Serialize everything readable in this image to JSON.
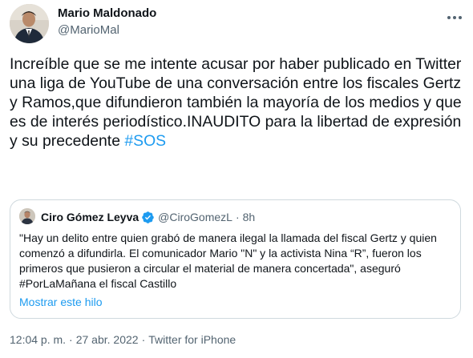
{
  "author": {
    "name": "Mario Maldonado",
    "handle": "@MarioMal"
  },
  "tweet": {
    "text": "Increíble que se me intente acusar por haber publicado en Twitter una liga de YouTube de una conversación entre los fiscales Gertz y Ramos,que difundieron también la mayoría de los medios y que es de interés periodístico.INAUDITO para la libertad de expresión y su precedente ",
    "hashtag": "#SOS"
  },
  "quote": {
    "name": "Ciro Gómez Leyva",
    "handle": "@CiroGomezL",
    "separator": "·",
    "time": "8h",
    "text": "\"Hay un delito entre quien grabó de manera ilegal la llamada del fiscal Gertz y quien comenzó a difundirla. El comunicador Mario \"N\" y la activista Nina “R”, fueron los primeros que pusieron a circular el material de manera concertada\", aseguró #PorLaMañana el fiscal Castillo",
    "show_thread": "Mostrar este hilo",
    "verified": true
  },
  "meta": {
    "time": "12:04 p. m.",
    "date": "27 abr. 2022",
    "source": "Twitter for iPhone",
    "separator": "·"
  },
  "colors": {
    "text": "#0f1419",
    "secondary": "#536471",
    "accent": "#1d9bf0",
    "border": "#cfd9de"
  },
  "icons": {
    "more": "more-horizontal-icon",
    "verified": "verified-badge-icon"
  }
}
